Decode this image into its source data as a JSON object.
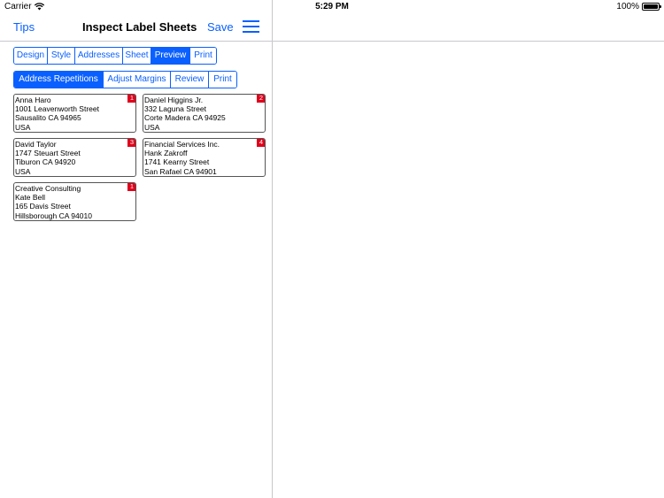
{
  "status_bar": {
    "carrier": "Carrier",
    "time": "5:29 PM",
    "battery": "100%"
  },
  "nav": {
    "left": "Tips",
    "title": "Inspect Label Sheets",
    "right": "Save",
    "menu_icon": "hamburger-menu-icon"
  },
  "tabs_main": [
    {
      "label": "Design",
      "selected": false
    },
    {
      "label": "Style",
      "selected": false
    },
    {
      "label": "Addresses",
      "selected": false
    },
    {
      "label": "Sheet",
      "selected": false
    },
    {
      "label": "Preview",
      "selected": true
    },
    {
      "label": "Print",
      "selected": false
    }
  ],
  "tabs_sub": [
    {
      "label": "Address Repetitions",
      "selected": true
    },
    {
      "label": "Adjust Margins",
      "selected": false
    },
    {
      "label": "Review",
      "selected": false
    },
    {
      "label": "Print",
      "selected": false
    }
  ],
  "labels": [
    {
      "count": "1",
      "lines": [
        "Anna Haro",
        "1001  Leavenworth Street",
        "Sausalito CA 94965",
        "USA"
      ]
    },
    {
      "count": "2",
      "lines": [
        "Daniel Higgins Jr.",
        "332 Laguna Street",
        "Corte Madera CA 94925",
        "USA"
      ]
    },
    {
      "count": "3",
      "lines": [
        "David Taylor",
        "1747 Steuart Street",
        "Tiburon CA 94920",
        "USA"
      ]
    },
    {
      "count": "4",
      "lines": [
        "Financial Services Inc.",
        "Hank Zakroff",
        "1741 Kearny Street",
        "San Rafael CA 94901"
      ]
    },
    {
      "count": "1",
      "lines": [
        "Creative Consulting",
        "Kate Bell",
        "165 Davis Street",
        "Hillsborough CA 94010"
      ]
    }
  ],
  "colors": {
    "accent": "#0a60ff",
    "badge": "#e0001b"
  }
}
